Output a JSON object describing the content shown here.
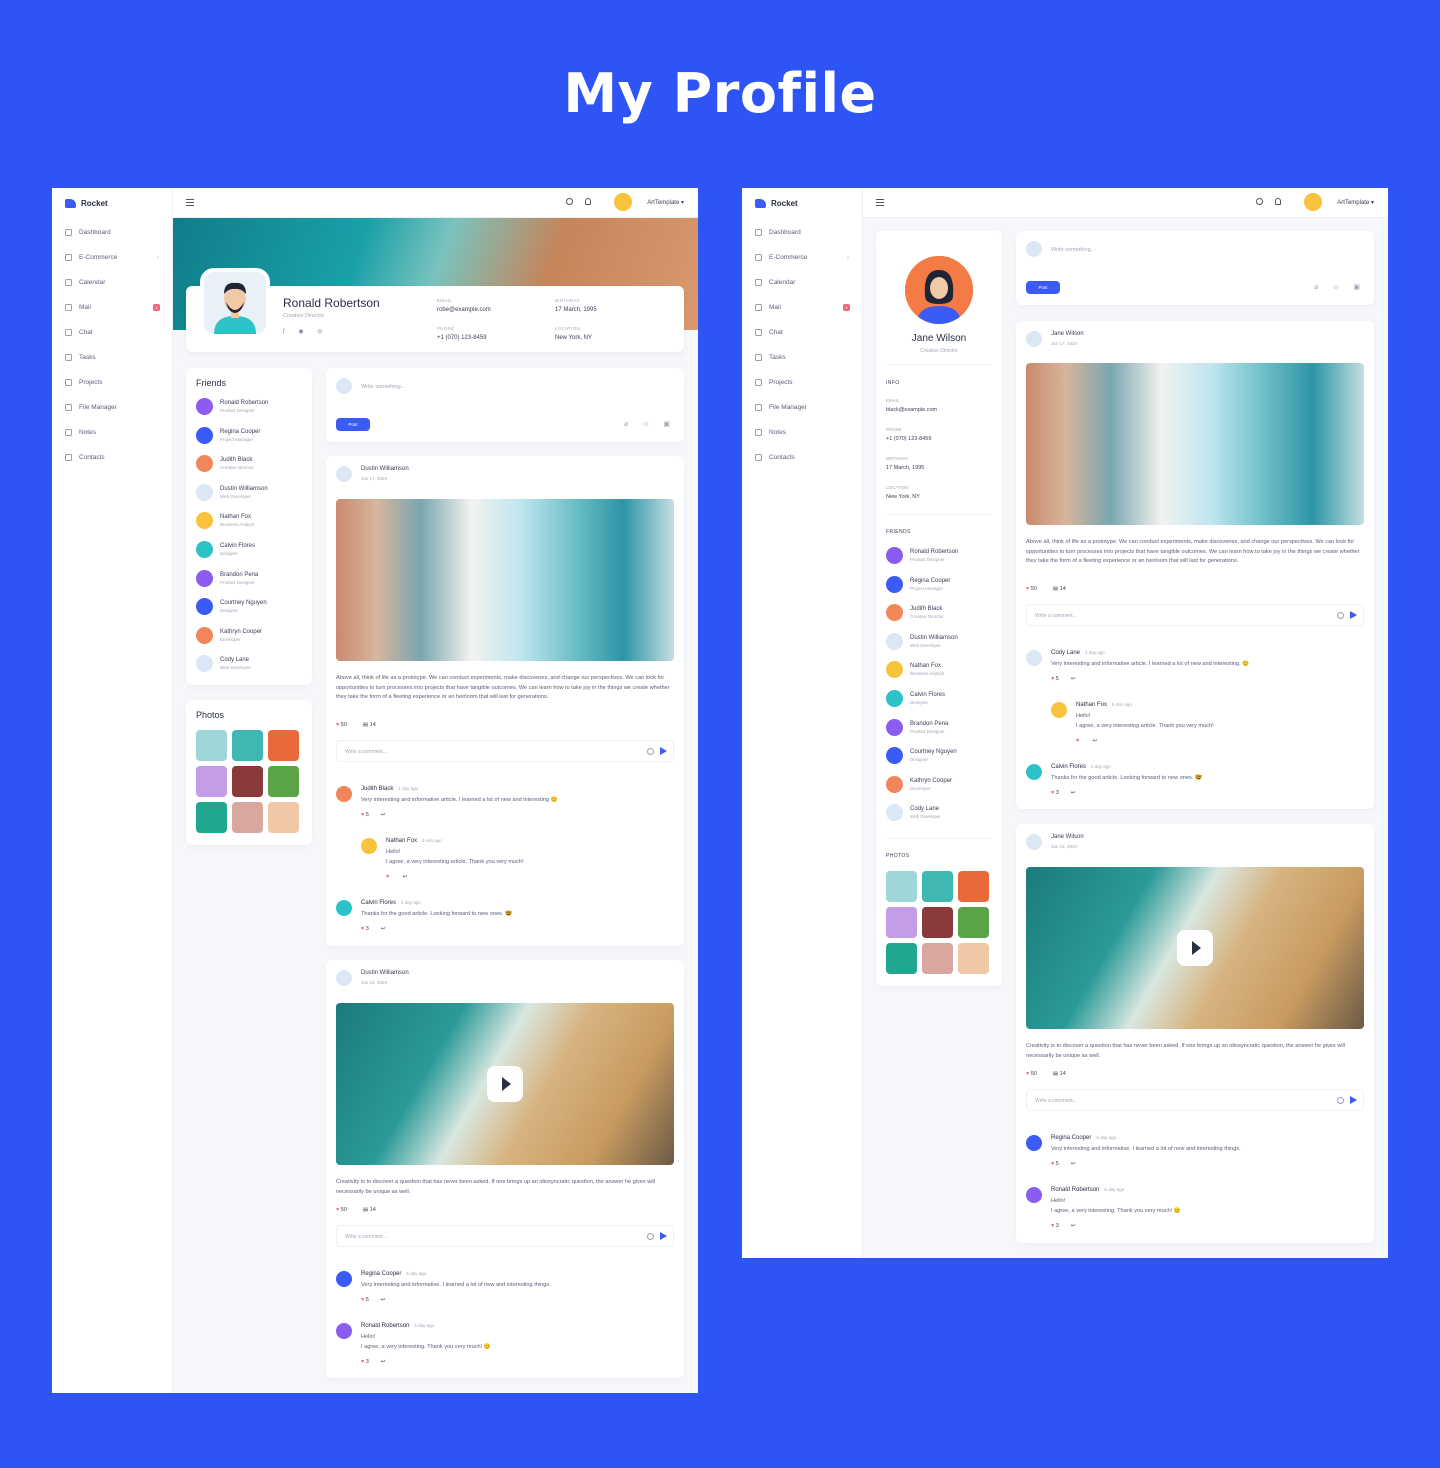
{
  "page_title": "My Profile",
  "app": {
    "brand": "Rocket",
    "user": "ArtTemplate ▾"
  },
  "nav": [
    {
      "label": "Dashboard",
      "icon": "grid-icon"
    },
    {
      "label": "E-Commerce",
      "icon": "cart-icon",
      "chevron": "›"
    },
    {
      "label": "Calendar",
      "icon": "calendar-icon"
    },
    {
      "label": "Mail",
      "icon": "mail-icon",
      "badge": "4"
    },
    {
      "label": "Chat",
      "icon": "chat-icon"
    },
    {
      "label": "Tasks",
      "icon": "tasks-icon"
    },
    {
      "label": "Projects",
      "icon": "layers-icon"
    },
    {
      "label": "File Manager",
      "icon": "folder-icon"
    },
    {
      "label": "Notes",
      "icon": "notes-icon"
    },
    {
      "label": "Contacts",
      "icon": "contacts-icon"
    }
  ],
  "profile1": {
    "name": "Ronald Robertson",
    "role": "Creative Director",
    "social": "f ◉ ◎",
    "email_label": "EMAIL",
    "email": "robe@example.com",
    "birthday_label": "BIRTHDAY",
    "birthday": "17 March, 1995",
    "phone_label": "PHONE",
    "phone": "+1 (070) 123-8459",
    "location_label": "LOCATION",
    "location": "New York, NY"
  },
  "profile2": {
    "name": "Jane Wilson",
    "role": "Creative Director",
    "info_label": "INFO",
    "email_label": "EMAIL",
    "email": "black@example.com",
    "phone_label": "PHONE",
    "phone": "+1 (070) 123-8459",
    "birthday_label": "BIRTHDAY",
    "birthday": "17 March, 1995",
    "location_label": "LOCATION",
    "location": "New York, NY",
    "friends_label": "FRIENDS",
    "photos_label": "PHOTOS"
  },
  "friends_title": "Friends",
  "photos_title": "Photos",
  "friends": [
    {
      "name": "Ronald Robertson",
      "role": "Product Designer",
      "color": "#8a5cf0"
    },
    {
      "name": "Regina Cooper",
      "role": "Project Manager",
      "color": "#3b5bf6"
    },
    {
      "name": "Judith Black",
      "role": "Creative Director",
      "color": "#f0865a"
    },
    {
      "name": "Dustin Williamson",
      "role": "Web Developer",
      "color": "#dce7f5"
    },
    {
      "name": "Nathan Fox",
      "role": "Business Analyst",
      "color": "#f8c23c"
    },
    {
      "name": "Calvin Flores",
      "role": "Designer",
      "color": "#2cc2c7"
    },
    {
      "name": "Brandon Pena",
      "role": "Product Designer",
      "color": "#8a5cf0"
    },
    {
      "name": "Courtney Nguyen",
      "role": "Designer",
      "color": "#3b5bf6"
    },
    {
      "name": "Kathryn Cooper",
      "role": "Developer",
      "color": "#f0865a"
    },
    {
      "name": "Cody Lane",
      "role": "Web Developer",
      "color": "#dce7f5"
    }
  ],
  "photo_colors": [
    "#9fd6d8",
    "#3fb7b3",
    "#e86a3a",
    "#c39de6",
    "#8a3a3a",
    "#5aa348",
    "#1fa88e",
    "#d8a7a0",
    "#f1c8a6"
  ],
  "composer": {
    "placeholder": "Write something...",
    "post_label": "Post",
    "icons": "⌀ ☺ ▣"
  },
  "feed1": [
    {
      "author": "Dustin Williamson",
      "date": "Jan 17, 2020",
      "media": "city",
      "text": "Above all, think of life as a prototype. We can conduct experiments, make discoveries, and change our perspectives. We can look for opportunities to turn processes into projects that have tangible outcomes. We can learn how to take joy in the things we create whether they take the form of a fleeting experience or an heirloom that will last for generations.",
      "likes": "50",
      "comments": "14",
      "comment_placeholder": "Write a comment...",
      "replies": [
        {
          "name": "Judith Black",
          "time": "1 day ago",
          "text": "Very interesting and informative article. I learned a lot of new and interesting 😊",
          "likes": "5",
          "color": "#f0865a"
        },
        {
          "name": "Nathan Fox",
          "time": "5 min ago",
          "text": "Hello!",
          "text2": "I agree, a very interesting article. Thank you very much!",
          "likes": "",
          "color": "#f8c23c"
        },
        {
          "name": "Calvin Flores",
          "time": "2 day ago",
          "text": "Thanks for the good article. Looking forward to new ones. 🤓",
          "likes": "3",
          "color": "#2cc2c7"
        }
      ]
    },
    {
      "author": "Dustin Williamson",
      "date": "Jan 15, 2020",
      "media": "beach",
      "text": "Creativity is to discover a question that has never been asked. If one brings up an idiosyncratic question, the answer he gives will necessarily be unique as well.",
      "likes": "50",
      "comments": "14",
      "comment_placeholder": "Write a comment...",
      "replies": [
        {
          "name": "Regina Cooper",
          "time": "5 day ago",
          "text": "Very interesting and informative. I learned a lot of new and interesting things.",
          "likes": "5",
          "color": "#3b5bf6"
        },
        {
          "name": "Ronald Robertson",
          "time": "5 day ago",
          "text": "Hello!",
          "text2": "I agree, a very interesting. Thank you very much! 😊",
          "likes": "3",
          "color": "#8a5cf0"
        }
      ]
    }
  ],
  "feed2": [
    {
      "author": "Jane Wilson",
      "date": "Jan 17, 2020",
      "text": "Above all, think of life as a prototype. We can conduct experiments, make discoveries, and change our perspectives. We can look for opportunities to turn processes into projects that have tangible outcomes. We can learn how to take joy in the things we create whether they take the form of a fleeting experience or an heirloom that will last for generations.",
      "likes": "50",
      "comments": "14",
      "comment_placeholder": "Write a comment...",
      "replies": [
        {
          "name": "Cody Lane",
          "time": "1 day ago",
          "text": "Very interesting and informative article. I learned a lot of new and interesting. 😊",
          "likes": "5",
          "color": "#dce7f5"
        },
        {
          "name": "Nathan Fox",
          "time": "5 min ago",
          "text": "Hello!",
          "text2": "I agree, a very interesting article. Thank you very much!",
          "likes": "",
          "color": "#f8c23c"
        },
        {
          "name": "Calvin Flores",
          "time": "2 day ago",
          "text": "Thanks for the good article. Looking forward to new ones. 🤓",
          "likes": "3",
          "color": "#2cc2c7"
        }
      ]
    },
    {
      "author": "Jane Wilson",
      "date": "Jan 15, 2020",
      "text": "Creativity is to discover a question that has never been asked. If one brings up an idiosyncratic question, the answer he gives will necessarily be unique as well.",
      "likes": "50",
      "comments": "14",
      "comment_placeholder": "Write a comment...",
      "replies": [
        {
          "name": "Regina Cooper",
          "time": "5 day ago",
          "text": "Very interesting and informative. I learned a lot of new and interesting things.",
          "likes": "5",
          "color": "#3b5bf6"
        },
        {
          "name": "Ronald Robertson",
          "time": "5 day ago",
          "text": "Hello!",
          "text2": "I agree, a very interesting. Thank you very much! 😊",
          "likes": "3",
          "color": "#8a5cf0"
        }
      ]
    }
  ]
}
